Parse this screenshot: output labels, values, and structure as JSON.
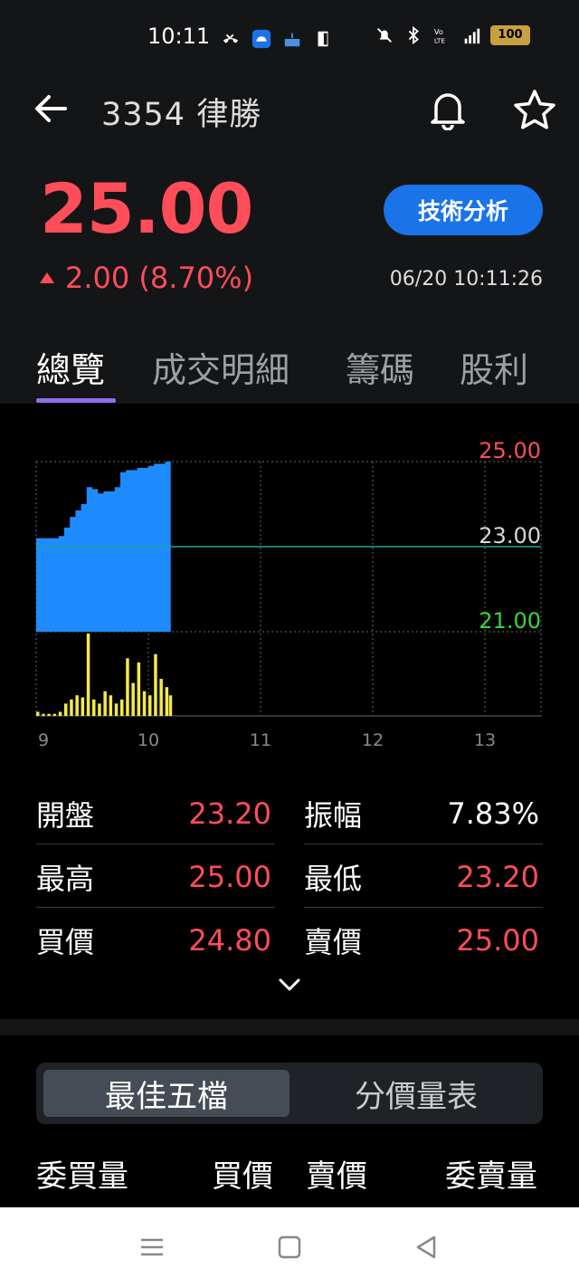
{
  "status_bar": {
    "time": "10:11",
    "battery": "100"
  },
  "header": {
    "title": "3354 律勝",
    "price": "25.00",
    "change": "2.00 (8.70%)",
    "timestamp": "06/20 10:11:26",
    "tech_button": "技術分析"
  },
  "tabs": [
    "總覽",
    "成交明細",
    "籌碼",
    "股利"
  ],
  "chart": {
    "y_labels": {
      "high": "25.00",
      "mid": "23.00",
      "low": "21.00"
    },
    "x_labels": [
      "9",
      "10",
      "11",
      "12",
      "13"
    ],
    "colors": {
      "price_fill": "#1e8cff",
      "volume": "#f2e94a",
      "high": "#ff4d5a",
      "mid": "#d8d8d8",
      "low": "#36d63a",
      "ref_line": "#1aa598"
    }
  },
  "chart_data": {
    "type": "area",
    "price": {
      "x": [
        "09:00",
        "09:03",
        "09:06",
        "09:09",
        "09:12",
        "09:15",
        "09:18",
        "09:21",
        "09:24",
        "09:27",
        "09:30",
        "09:33",
        "09:36",
        "09:39",
        "09:42",
        "09:45",
        "09:48",
        "09:51",
        "09:54",
        "09:57",
        "10:00",
        "10:03",
        "10:06",
        "10:09",
        "10:11"
      ],
      "values": [
        23.2,
        23.2,
        23.2,
        23.2,
        23.25,
        23.45,
        23.7,
        23.85,
        24.0,
        24.4,
        24.35,
        24.25,
        24.3,
        24.3,
        24.4,
        24.75,
        24.8,
        24.8,
        24.85,
        24.85,
        24.9,
        24.95,
        24.95,
        25.0,
        25.0
      ]
    },
    "volume": {
      "x": [
        "09:00",
        "09:03",
        "09:06",
        "09:09",
        "09:12",
        "09:15",
        "09:18",
        "09:21",
        "09:24",
        "09:27",
        "09:30",
        "09:33",
        "09:36",
        "09:39",
        "09:42",
        "09:45",
        "09:48",
        "09:51",
        "09:54",
        "09:57",
        "10:00",
        "10:03",
        "10:06",
        "10:09",
        "10:11"
      ],
      "values": [
        2,
        1,
        1,
        1,
        2,
        6,
        8,
        10,
        9,
        40,
        8,
        6,
        12,
        10,
        6,
        8,
        28,
        16,
        26,
        12,
        10,
        30,
        18,
        14,
        10
      ]
    },
    "reference_price": 23.0,
    "ylim": [
      21.0,
      25.0
    ],
    "x_ticks": [
      "9",
      "10",
      "11",
      "12",
      "13"
    ]
  },
  "stats": {
    "open_label": "開盤",
    "open": "23.20",
    "amp_label": "振幅",
    "amp": "7.83%",
    "high_label": "最高",
    "high": "25.00",
    "low_label": "最低",
    "low": "23.20",
    "bid_label": "買價",
    "bid": "24.80",
    "ask_label": "賣價",
    "ask": "25.00"
  },
  "segment": {
    "a": "最佳五檔",
    "b": "分價量表"
  },
  "orderbook_headers": [
    "委買量",
    "買價",
    "賣價",
    "委賣量"
  ]
}
